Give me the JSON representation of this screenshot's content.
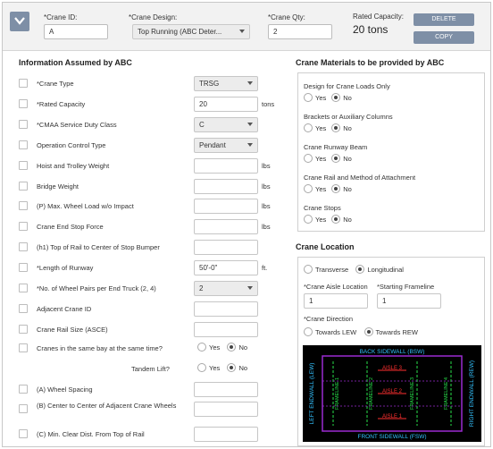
{
  "header": {
    "crane_id_label": "*Crane ID:",
    "crane_id_value": "A",
    "crane_design_label": "*Crane Design:",
    "crane_design_value": "Top Running (ABC Deter...",
    "crane_qty_label": "*Crane Qty:",
    "crane_qty_value": "2",
    "rated_capacity_label": "Rated Capacity:",
    "rated_capacity_value": "20 tons",
    "delete_label": "DELETE",
    "copy_label": "COPY"
  },
  "left": {
    "title": "Information Assumed by ABC",
    "rows": [
      {
        "label": "*Crane Type",
        "value": "TRSG",
        "kind": "select",
        "unit": ""
      },
      {
        "label": "*Rated Capacity",
        "value": "20",
        "kind": "input",
        "unit": "tons"
      },
      {
        "label": "*CMAA Service Duty Class",
        "value": "C",
        "kind": "select",
        "unit": ""
      },
      {
        "label": "Operation Control Type",
        "value": "Pendant",
        "kind": "select",
        "unit": ""
      },
      {
        "label": "Hoist and Trolley Weight",
        "value": "",
        "kind": "input",
        "unit": "lbs"
      },
      {
        "label": "Bridge Weight",
        "value": "",
        "kind": "input",
        "unit": "lbs"
      },
      {
        "label": "(P) Max. Wheel Load w/o Impact",
        "value": "",
        "kind": "input",
        "unit": "lbs"
      },
      {
        "label": "Crane End Stop Force",
        "value": "",
        "kind": "input",
        "unit": "lbs"
      },
      {
        "label": "(h1) Top of Rail to Center of Stop Bumper",
        "value": "",
        "kind": "input",
        "unit": ""
      },
      {
        "label": "*Length of Runway",
        "value": "50'-0\"",
        "kind": "input",
        "unit": "ft."
      },
      {
        "label": "*No. of Wheel Pairs per End Truck (2, 4)",
        "value": "2",
        "kind": "select",
        "unit": ""
      },
      {
        "label": "Adjacent Crane ID",
        "value": "",
        "kind": "input",
        "unit": ""
      },
      {
        "label": "Crane Rail Size (ASCE)",
        "value": "",
        "kind": "input",
        "unit": ""
      }
    ],
    "same_bay_label": "Cranes in the same bay at the same time?",
    "tandem_label": "Tandem Lift?",
    "yes": "Yes",
    "no": "No",
    "bottom_rows": [
      {
        "label": "(A) Wheel Spacing"
      },
      {
        "label": "(B) Center to Center of Adjacent Crane Wheels"
      },
      {
        "label": "(C) Min. Clear Dist. From Top of Rail"
      }
    ]
  },
  "materials": {
    "title": "Crane Materials to be provided by ABC",
    "items": [
      {
        "label": "Design for Crane Loads Only"
      },
      {
        "label": "Brackets or Auxiliary Columns"
      },
      {
        "label": "Crane Runway Beam"
      },
      {
        "label": "Crane Rail and Method of Attachment"
      },
      {
        "label": "Crane Stops"
      }
    ],
    "yes": "Yes",
    "no": "No"
  },
  "location": {
    "title": "Crane Location",
    "transverse": "Transverse",
    "longitudinal": "Longitudinal",
    "aisle_label": "*Crane Aisle Location",
    "aisle_value": "1",
    "frameline_label": "*Starting Frameline",
    "frameline_value": "1",
    "direction_label": "*Crane Direction",
    "towards_lew": "Towards LEW",
    "towards_rew": "Towards REW"
  },
  "diagram": {
    "back": "BACK SIDEWALL (BSW)",
    "front": "FRONT SIDEWALL (FSW)",
    "left": "LEFT ENDWALL (LEW)",
    "right": "RIGHT ENDWALL (REW)",
    "aisle1": "AISLE 1",
    "aisle2": "AISLE 2",
    "aisle3": "AISLE 3",
    "frameline1": "FRAMELINE 1",
    "frameline2": "FRAMELINE 2",
    "frameline3": "FRAMELINE 3",
    "frameline4": "FRAMELINE 4",
    "colors": {
      "border": "#9b2bd1",
      "text": "#33c2ff",
      "aisle": "#ff3030",
      "frameline": "#27e04a"
    }
  }
}
